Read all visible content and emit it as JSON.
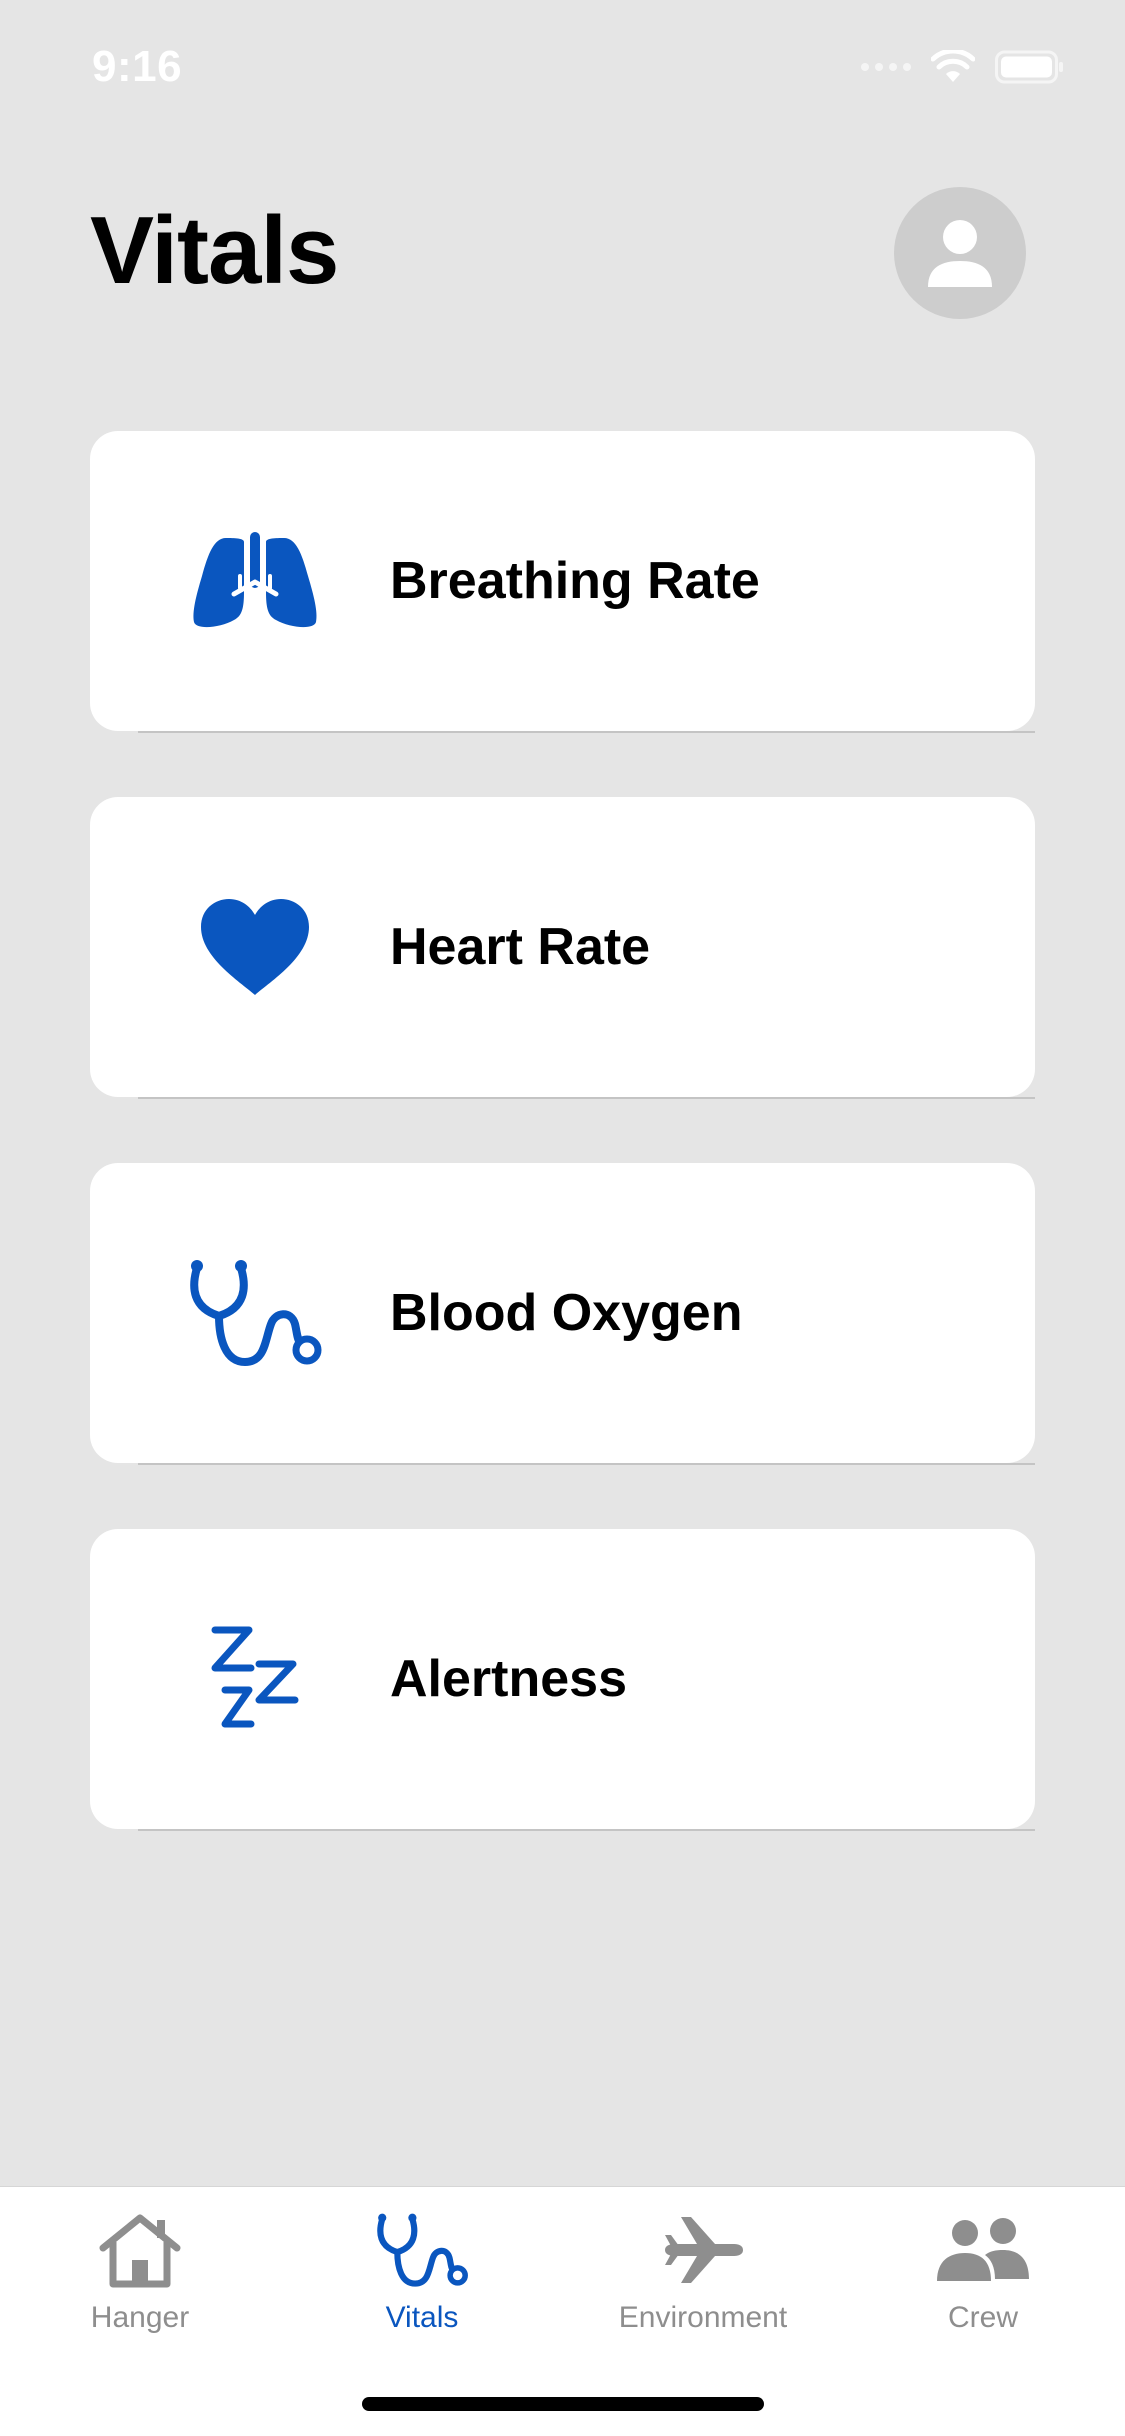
{
  "status_bar": {
    "time": "9:16"
  },
  "header": {
    "title": "Vitals"
  },
  "cards": [
    {
      "label": "Breathing Rate",
      "icon": "lungs-icon"
    },
    {
      "label": "Heart Rate",
      "icon": "heart-icon"
    },
    {
      "label": "Blood Oxygen",
      "icon": "stethoscope-icon"
    },
    {
      "label": "Alertness",
      "icon": "zzz-icon"
    }
  ],
  "tabs": [
    {
      "label": "Hanger",
      "icon": "house-icon",
      "active": false
    },
    {
      "label": "Vitals",
      "icon": "stethoscope-icon",
      "active": true
    },
    {
      "label": "Environment",
      "icon": "airplane-icon",
      "active": false
    },
    {
      "label": "Crew",
      "icon": "people-icon",
      "active": false
    }
  ],
  "colors": {
    "accent": "#0a56bf",
    "background": "#e5e5e5",
    "card": "#ffffff",
    "inactive_tab": "#8e8e8e"
  }
}
